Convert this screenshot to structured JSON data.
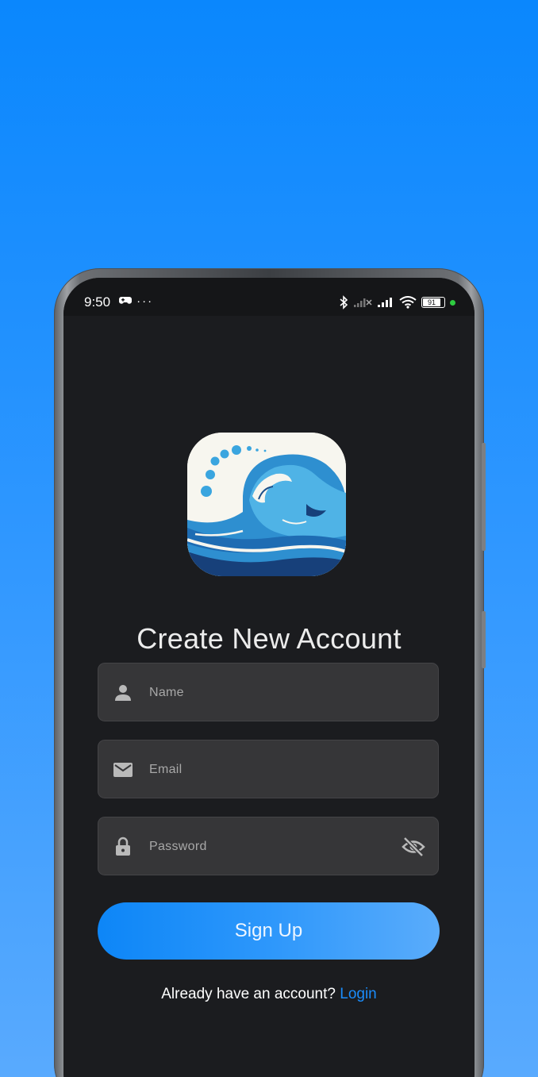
{
  "status_bar": {
    "time": "9:50",
    "left_icons": [
      "game-controller-icon",
      "more-dots-icon"
    ],
    "more_dots": "···",
    "right_icons": [
      "bluetooth-icon",
      "signal-off-icon",
      "signal-icon",
      "wifi-icon",
      "battery-icon"
    ],
    "battery_level": "91"
  },
  "app": {
    "logo_icon": "wave-logo-icon",
    "title": "Create New Account"
  },
  "form": {
    "name": {
      "placeholder": "Name",
      "value": "",
      "icon": "person-icon"
    },
    "email": {
      "placeholder": "Email",
      "value": "",
      "icon": "mail-icon"
    },
    "password": {
      "placeholder": "Password",
      "value": "",
      "icon": "lock-icon",
      "toggle_icon": "eye-off-icon"
    },
    "submit_label": "Sign Up"
  },
  "footer": {
    "prompt": "Already have an account?",
    "link_label": "Login"
  },
  "colors": {
    "accent": "#1a8cfb",
    "background_top": "#0a87fd",
    "screen_bg": "#1b1c1f",
    "field_bg": "#363638"
  }
}
